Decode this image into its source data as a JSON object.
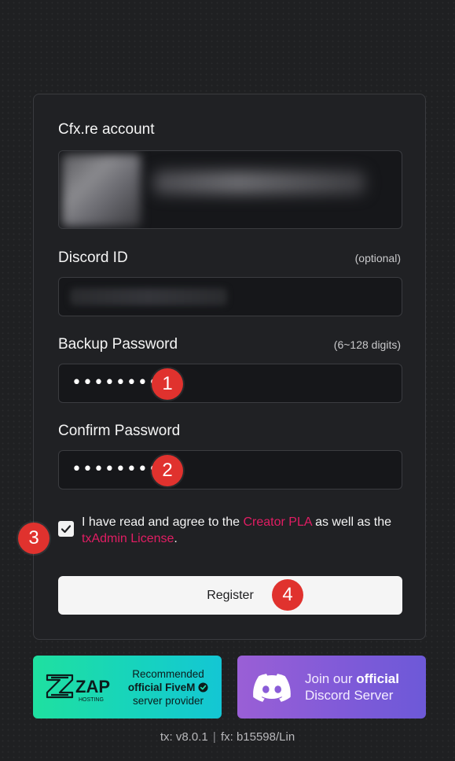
{
  "form": {
    "account_label": "Cfx.re account",
    "discord_label": "Discord ID",
    "discord_hint": "(optional)",
    "backup_label": "Backup Password",
    "backup_hint": "(6~128 digits)",
    "backup_value": "••••••••",
    "confirm_label": "Confirm Password",
    "confirm_value": "••••••••",
    "agree_checked": true,
    "agree_text_1": "I have read and agree to the ",
    "agree_link_1": "Creator PLA",
    "agree_text_2": " as well as the ",
    "agree_link_2": "txAdmin License",
    "agree_text_3": ".",
    "register_label": "Register"
  },
  "annotations": [
    "1",
    "2",
    "3",
    "4"
  ],
  "banners": {
    "zap": {
      "logo_text": "ZAP",
      "logo_sub": "HOSTING",
      "line1": "Recommended",
      "line2": "official FiveM",
      "line3": "server provider"
    },
    "discord": {
      "line1_plain": "Join our ",
      "line1_strong": "official",
      "line2": "Discord Server"
    }
  },
  "footer": {
    "tx_version": "tx: v8.0.1",
    "separator": "|",
    "fx_version": "fx: b15598/Lin"
  },
  "colors": {
    "accent_link": "#e11d63",
    "badge": "#e0322e",
    "zap_gradient_start": "#1fe0a0",
    "discord_gradient_start": "#9a5fd6"
  }
}
